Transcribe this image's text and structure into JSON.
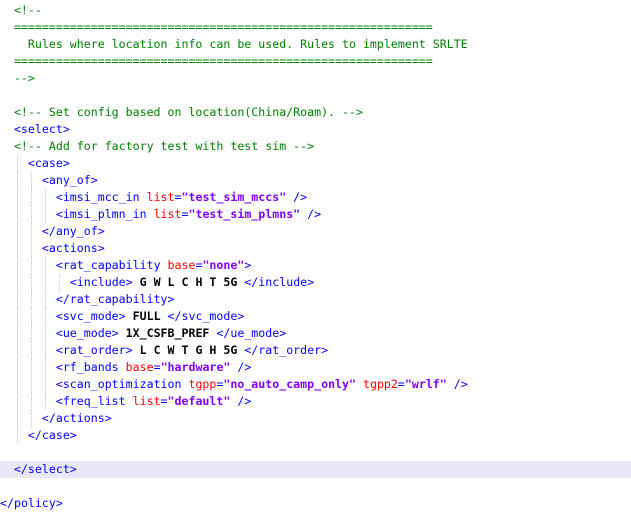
{
  "colors": {
    "comment": "#008000",
    "tag": "#0000ff",
    "attribute": "#ff0000",
    "value": "#8000ff",
    "text": "#000000",
    "current_line": "#e8e8f8"
  },
  "lines": [
    {
      "name": "line-comment-open",
      "indent": 2,
      "hl": false,
      "tokens": [
        {
          "t": "cm",
          "v": "<!--"
        }
      ]
    },
    {
      "name": "line-comment-rule-top",
      "indent": 2,
      "hl": false,
      "tokens": [
        {
          "t": "cm",
          "v": "============================================================"
        }
      ]
    },
    {
      "name": "line-comment-title",
      "indent": 2,
      "hl": false,
      "tokens": [
        {
          "t": "cm",
          "v": "  Rules where location info can be used. Rules to implement SRLTE"
        }
      ]
    },
    {
      "name": "line-comment-rule-bottom",
      "indent": 2,
      "hl": false,
      "tokens": [
        {
          "t": "cm",
          "v": "============================================================"
        }
      ]
    },
    {
      "name": "line-comment-close",
      "indent": 2,
      "hl": false,
      "tokens": [
        {
          "t": "cm",
          "v": "-->"
        }
      ]
    },
    {
      "name": "line-blank-1",
      "indent": 0,
      "hl": false,
      "tokens": []
    },
    {
      "name": "line-comment-location",
      "indent": 2,
      "hl": false,
      "tokens": [
        {
          "t": "cm",
          "v": "<!-- Set config based on location(China/Roam). -->"
        }
      ]
    },
    {
      "name": "line-select-open",
      "indent": 2,
      "hl": false,
      "tokens": [
        {
          "t": "tag",
          "v": "<select>"
        }
      ]
    },
    {
      "name": "line-comment-factory",
      "indent": 2,
      "hl": false,
      "tokens": [
        {
          "t": "cm",
          "v": "<!-- Add for factory test with test sim -->"
        }
      ]
    },
    {
      "name": "line-case-open",
      "indent": 4,
      "hl": false,
      "tokens": [
        {
          "t": "tag",
          "v": "<case>"
        }
      ]
    },
    {
      "name": "line-any-of-open",
      "indent": 6,
      "hl": false,
      "tokens": [
        {
          "t": "tag",
          "v": "<any_of>"
        }
      ]
    },
    {
      "name": "line-imsi-mcc-in",
      "indent": 8,
      "hl": false,
      "tokens": [
        {
          "t": "tag",
          "v": "<imsi_mcc_in "
        },
        {
          "t": "attr",
          "v": "list"
        },
        {
          "t": "tag",
          "v": "="
        },
        {
          "t": "val",
          "v": "\"test_sim_mccs\""
        },
        {
          "t": "tag",
          "v": " />"
        }
      ]
    },
    {
      "name": "line-imsi-plmn-in",
      "indent": 8,
      "hl": false,
      "tokens": [
        {
          "t": "tag",
          "v": "<imsi_plmn_in "
        },
        {
          "t": "attr",
          "v": "list"
        },
        {
          "t": "tag",
          "v": "="
        },
        {
          "t": "val",
          "v": "\"test_sim_plmns\""
        },
        {
          "t": "tag",
          "v": " />"
        }
      ]
    },
    {
      "name": "line-any-of-close",
      "indent": 6,
      "hl": false,
      "tokens": [
        {
          "t": "tag",
          "v": "</any_of>"
        }
      ]
    },
    {
      "name": "line-actions-open",
      "indent": 6,
      "hl": false,
      "tokens": [
        {
          "t": "tag",
          "v": "<actions>"
        }
      ]
    },
    {
      "name": "line-rat-capability-open",
      "indent": 8,
      "hl": false,
      "tokens": [
        {
          "t": "tag",
          "v": "<rat_capability "
        },
        {
          "t": "attr",
          "v": "base"
        },
        {
          "t": "tag",
          "v": "="
        },
        {
          "t": "val",
          "v": "\"none\""
        },
        {
          "t": "tag",
          "v": ">"
        }
      ]
    },
    {
      "name": "line-include",
      "indent": 10,
      "hl": false,
      "tokens": [
        {
          "t": "tag",
          "v": "<include>"
        },
        {
          "t": "txt",
          "v": " G W L C H T 5G "
        },
        {
          "t": "tag",
          "v": "</include>"
        }
      ]
    },
    {
      "name": "line-rat-capability-close",
      "indent": 8,
      "hl": false,
      "tokens": [
        {
          "t": "tag",
          "v": "</rat_capability>"
        }
      ]
    },
    {
      "name": "line-svc-mode",
      "indent": 8,
      "hl": false,
      "tokens": [
        {
          "t": "tag",
          "v": "<svc_mode>"
        },
        {
          "t": "txt",
          "v": " FULL "
        },
        {
          "t": "tag",
          "v": "</svc_mode>"
        }
      ]
    },
    {
      "name": "line-ue-mode",
      "indent": 8,
      "hl": false,
      "tokens": [
        {
          "t": "tag",
          "v": "<ue_mode>"
        },
        {
          "t": "txt",
          "v": " 1X_CSFB_PREF "
        },
        {
          "t": "tag",
          "v": "</ue_mode>"
        }
      ]
    },
    {
      "name": "line-rat-order",
      "indent": 8,
      "hl": false,
      "tokens": [
        {
          "t": "tag",
          "v": "<rat_order>"
        },
        {
          "t": "txt",
          "v": " L C W T G H 5G "
        },
        {
          "t": "tag",
          "v": "</rat_order>"
        }
      ]
    },
    {
      "name": "line-rf-bands",
      "indent": 8,
      "hl": false,
      "tokens": [
        {
          "t": "tag",
          "v": "<rf_bands "
        },
        {
          "t": "attr",
          "v": "base"
        },
        {
          "t": "tag",
          "v": "="
        },
        {
          "t": "val",
          "v": "\"hardware\""
        },
        {
          "t": "tag",
          "v": " />"
        }
      ]
    },
    {
      "name": "line-scan-optimization",
      "indent": 8,
      "hl": false,
      "tokens": [
        {
          "t": "tag",
          "v": "<scan_optimization "
        },
        {
          "t": "attr",
          "v": "tgpp"
        },
        {
          "t": "tag",
          "v": "="
        },
        {
          "t": "val",
          "v": "\"no_auto_camp_only\""
        },
        {
          "t": "tag",
          "v": " "
        },
        {
          "t": "attr",
          "v": "tgpp2"
        },
        {
          "t": "tag",
          "v": "="
        },
        {
          "t": "val",
          "v": "\"wrlf\""
        },
        {
          "t": "tag",
          "v": " />"
        }
      ]
    },
    {
      "name": "line-freq-list",
      "indent": 8,
      "hl": false,
      "tokens": [
        {
          "t": "tag",
          "v": "<freq_list "
        },
        {
          "t": "attr",
          "v": "list"
        },
        {
          "t": "tag",
          "v": "="
        },
        {
          "t": "val",
          "v": "\"default\""
        },
        {
          "t": "tag",
          "v": " />"
        }
      ]
    },
    {
      "name": "line-actions-close",
      "indent": 6,
      "hl": false,
      "tokens": [
        {
          "t": "tag",
          "v": "</actions>"
        }
      ]
    },
    {
      "name": "line-case-close",
      "indent": 4,
      "hl": false,
      "tokens": [
        {
          "t": "tag",
          "v": "</case>"
        }
      ]
    },
    {
      "name": "line-blank-2",
      "indent": 0,
      "hl": false,
      "tokens": []
    },
    {
      "name": "line-select-close",
      "indent": 2,
      "hl": true,
      "tokens": [
        {
          "t": "tag",
          "v": "</select>"
        }
      ]
    },
    {
      "name": "line-blank-3",
      "indent": 0,
      "hl": false,
      "tokens": []
    },
    {
      "name": "line-policy-close",
      "indent": 0,
      "hl": false,
      "tokens": [
        {
          "t": "tag",
          "v": "</policy>"
        }
      ]
    }
  ]
}
